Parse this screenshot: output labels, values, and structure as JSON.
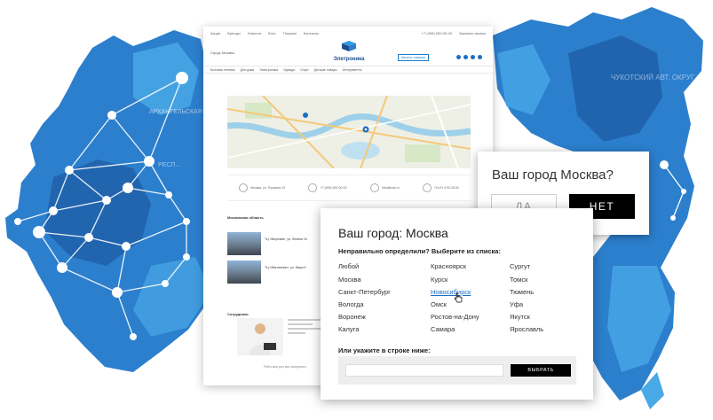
{
  "colors": {
    "map_dark": "#1f5fa8",
    "map_mid": "#2c7fcd",
    "map_light": "#49a8e6",
    "accent": "#1a6fc4",
    "button_dark": "#000000"
  },
  "map_labels": {
    "left_region": "АРХАНГЕЛЬСКАЯ ОБЛ.",
    "left_region2": "РЕСП...",
    "right_region": "ЧУКОТСКИЙ АВТ. ОКРУГ"
  },
  "site": {
    "topbar": [
      "Акции",
      "Бренды",
      "Новости",
      "Блог",
      "Покупки",
      "Контакты"
    ],
    "phone": "+7 (495) 000-00-00",
    "callback": "Заказать звонок",
    "city_selector": "Город: Москва",
    "logo_name": "Элетроника",
    "header_button": "Каталог товаров",
    "nav": [
      "Бытовая техника",
      "Для дома",
      "Электроника",
      "Одежда",
      "Спорт",
      "Детские товары",
      "Инструменты"
    ],
    "contacts": [
      "Москва, ул. Пушкина 10",
      "+7 (495) 000-00-00",
      "Info@mail.ru",
      "Пн-Пт 9:00-18:00"
    ],
    "section_title": "Московская область",
    "stores": [
      "ТЦ «Верхний», ул. Ленина 10",
      "ТЦ «Мегаполис», ул. Мира 5"
    ],
    "staff_title": "Сотрудники",
    "footer_note": "Работаем для вас ежедневно"
  },
  "dialog_confirm": {
    "question": "Ваш город Москва?",
    "yes_label": "ДА",
    "no_label": "НЕТ"
  },
  "dialog_city": {
    "title": "Ваш город: Москва",
    "subtitle": "Неправильно определили? Выберите из списка:",
    "cities_col1": [
      "Любой",
      "Москва",
      "Санкт-Петербург",
      "Вологда",
      "Воронеж",
      "Калуга"
    ],
    "cities_col2": [
      "Красноярск",
      "Курск",
      "Новосибирск",
      "Омск",
      "Ростов-на-Дону",
      "Самара"
    ],
    "cities_col3": [
      "Сургут",
      "Томск",
      "Тюмень",
      "Уфа",
      "Якутск",
      "Ярославль"
    ],
    "active_city": "Новосибирск",
    "manual_label": "Или укажите в строке ниже:",
    "input_value": "",
    "input_placeholder": "",
    "submit_label": "ВЫБРАТЬ"
  }
}
